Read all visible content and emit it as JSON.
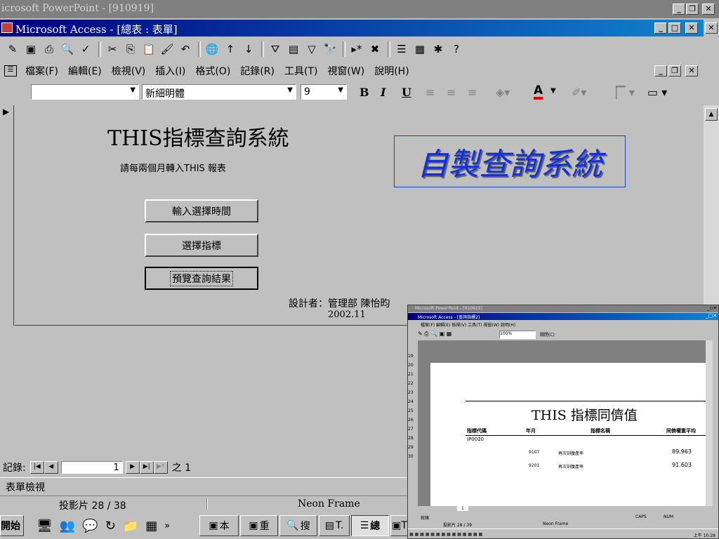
{
  "ppt": {
    "title": "icrosoft PowerPoint - [910919]"
  },
  "access": {
    "title": "Microsoft Access - [總表 : 表單]"
  },
  "menu": [
    "檔案(F)",
    "編輯(E)",
    "檢視(V)",
    "插入(I)",
    "格式(O)",
    "記錄(R)",
    "工具(T)",
    "視窗(W)",
    "說明(H)"
  ],
  "format_bar": {
    "font": "新細明體",
    "size": "9",
    "bold": "B",
    "italic": "I",
    "underline": "U",
    "font_color": "A"
  },
  "form": {
    "title": "THIS指標查詢系統",
    "subtitle": "請每兩個月轉入THIS 報表",
    "logo": "自製查詢系統",
    "buttons": [
      "輸入選擇時間",
      "選擇指標",
      "預覽查詢結果"
    ],
    "designer": "設計者：管理部 陳怡昀",
    "date": "2002.11"
  },
  "record_nav": {
    "label": "記錄:",
    "current": "1",
    "of": "之 1"
  },
  "status": {
    "view": "表單檢視",
    "slide": "投影片 28 / 38",
    "theme": "Neon Frame"
  },
  "taskbar": {
    "start": "開始",
    "buttons": [
      "本",
      "重",
      "搜",
      "T.",
      "總",
      "T"
    ]
  },
  "inset": {
    "ppt_title": "Microsoft PowerPoint - [910919]",
    "access_title": "Microsoft Access - [查詢指標2]",
    "menu": "檔案(F)  編輯(E)  檢視(V)  工具(T)  視窗(W)  說明(H)",
    "zoom": "100%",
    "close_label": "關閉(C)",
    "row_numbers": [
      "19",
      "20",
      "21",
      "22",
      "23",
      "24",
      "25",
      "26",
      "27",
      "28",
      "29",
      "30"
    ],
    "report_title": "THIS 指標同儕值",
    "headers": [
      "指標代碼",
      "年月",
      "指標名稱",
      "同儕權重平均"
    ],
    "group": "IP0020",
    "rows": [
      {
        "ym": "9107",
        "name": "再次剖腹產率",
        "value": "89.963"
      },
      {
        "ym": "9201",
        "name": "再次剖腹產率",
        "value": "91.603"
      }
    ],
    "page": "1",
    "status_left": "就緒",
    "caps": "CAPS",
    "num": "NUM",
    "slide": "投影片 28 / 39",
    "theme": "Neon Frame",
    "clock": "上午 10:28"
  }
}
